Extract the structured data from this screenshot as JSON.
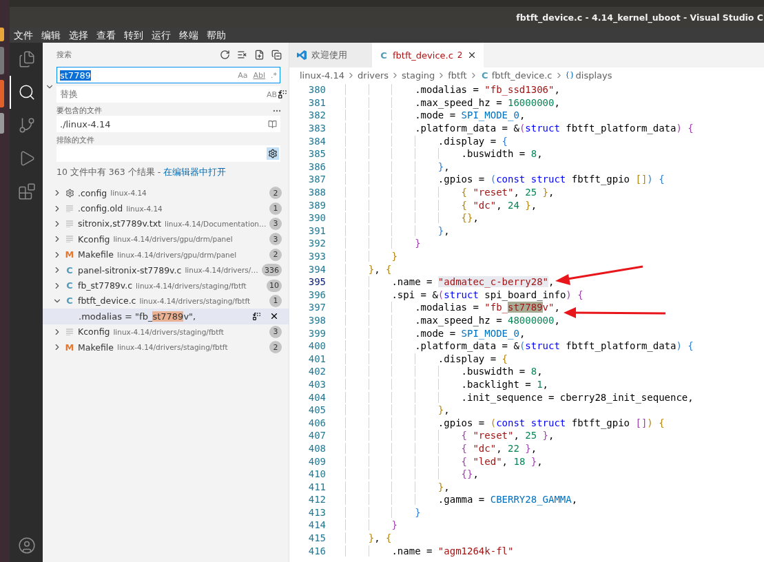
{
  "window": {
    "title": "fbtft_device.c - 4.14_kernel_uboot - Visual Studio C"
  },
  "menu": [
    "文件",
    "编辑",
    "选择",
    "查看",
    "转到",
    "运行",
    "终端",
    "帮助"
  ],
  "activity_bar": [
    {
      "kind": "files",
      "selected": false
    },
    {
      "kind": "search",
      "selected": true
    },
    {
      "kind": "branch",
      "selected": false
    },
    {
      "kind": "run",
      "selected": false
    },
    {
      "kind": "blocks",
      "selected": false
    },
    {
      "kind": "account",
      "selected": false
    }
  ],
  "search_panel": {
    "title": "搜索",
    "search": {
      "value": "st7789",
      "options": [
        "Aa",
        "Abl",
        ".*"
      ]
    },
    "replace": {
      "expanded": true,
      "placeholder": "替换",
      "option": "AB"
    },
    "include": {
      "label": "要包含的文件",
      "value": "./linux-4.14"
    },
    "exclude": {
      "label": "排除的文件",
      "use_ignore_files": true
    },
    "summary": "10 文件中有 363 个结果 - ",
    "open_in_editor": "在编辑器中打开",
    "results": [
      {
        "kind": "gear",
        "name": ".config",
        "path": "linux-4.14",
        "count": "2",
        "expanded": false
      },
      {
        "kind": "text",
        "name": ".config.old",
        "path": "linux-4.14",
        "count": "1",
        "expanded": false
      },
      {
        "kind": "text",
        "name": "sitronix,st7789v.txt",
        "path": "linux-4.14/Documentation…",
        "count": "3",
        "expanded": false
      },
      {
        "kind": "text",
        "name": "Kconfig",
        "path": "linux-4.14/drivers/gpu/drm/panel",
        "count": "3",
        "expanded": false
      },
      {
        "kind": "letter",
        "glyph": "M",
        "name": "Makefile",
        "path": "linux-4.14/drivers/gpu/drm/panel",
        "count": "2",
        "expanded": false
      },
      {
        "kind": "letter",
        "glyph": "C",
        "name": "panel-sitronix-st7789v.c",
        "path": "linux-4.14/drivers/…",
        "count": "336",
        "expanded": false
      },
      {
        "kind": "letter",
        "glyph": "C",
        "name": "fb_st7789v.c",
        "path": "linux-4.14/drivers/staging/fbtft",
        "count": "10",
        "expanded": false
      },
      {
        "kind": "letter",
        "glyph": "C",
        "name": "fbtft_device.c",
        "path": "linux-4.14/drivers/staging/fbtft",
        "count": "1",
        "expanded": true,
        "matches": [
          {
            "before": ".modalias = \"fb_",
            "match": "st7789",
            "after": "v\",",
            "selected": true
          }
        ]
      },
      {
        "kind": "text",
        "name": "Kconfig",
        "path": "linux-4.14/drivers/staging/fbtft",
        "count": "3",
        "expanded": false
      },
      {
        "kind": "letter",
        "glyph": "M",
        "name": "Makefile",
        "path": "linux-4.14/drivers/staging/fbtft",
        "count": "2",
        "expanded": false
      }
    ]
  },
  "tabs": [
    {
      "kind": "logo",
      "label": "欢迎使用",
      "selected": false
    },
    {
      "kind": "letter",
      "glyph": "C",
      "label": "fbtft_device.c",
      "problems": "2",
      "selected": true
    }
  ],
  "breadcrumb": [
    {
      "kind": "folder",
      "label": "linux-4.14"
    },
    {
      "kind": "folder",
      "label": "drivers"
    },
    {
      "kind": "folder",
      "label": "staging"
    },
    {
      "kind": "folder",
      "label": "fbtft"
    },
    {
      "kind": "letter",
      "glyph": "C",
      "label": "fbtft_device.c"
    },
    {
      "kind": "symbol",
      "label": "displays"
    }
  ],
  "code": [
    {
      "number": "380",
      "current": false,
      "tokens": [
        {
          "kind": "plain",
          "text": "            .modalias = "
        },
        {
          "kind": "string",
          "text": "\"fb_ssd1306\""
        },
        {
          "kind": "plain",
          "text": ","
        }
      ]
    },
    {
      "number": "381",
      "current": false,
      "tokens": [
        {
          "kind": "plain",
          "text": "            .max_speed_hz = "
        },
        {
          "kind": "number",
          "text": "16000000"
        },
        {
          "kind": "plain",
          "text": ","
        }
      ]
    },
    {
      "number": "382",
      "current": false,
      "tokens": [
        {
          "kind": "plain",
          "text": "            .mode = "
        },
        {
          "kind": "constant",
          "text": "SPI_MODE_0"
        },
        {
          "kind": "plain",
          "text": ","
        }
      ]
    },
    {
      "number": "383",
      "current": false,
      "tokens": [
        {
          "kind": "plain",
          "text": "            .platform_data = &"
        },
        {
          "kind": "bracket2",
          "text": "("
        },
        {
          "kind": "keyword",
          "text": "struct"
        },
        {
          "kind": "plain",
          "text": " fbtft_platform_data"
        },
        {
          "kind": "bracket2",
          "text": ") {"
        }
      ]
    },
    {
      "number": "384",
      "current": false,
      "tokens": [
        {
          "kind": "plain",
          "text": "                .display = "
        },
        {
          "kind": "bracket3",
          "text": "{"
        }
      ]
    },
    {
      "number": "385",
      "current": false,
      "tokens": [
        {
          "kind": "plain",
          "text": "                    .buswidth = "
        },
        {
          "kind": "number",
          "text": "8"
        },
        {
          "kind": "plain",
          "text": ","
        }
      ]
    },
    {
      "number": "386",
      "current": false,
      "tokens": [
        {
          "kind": "bracket3",
          "text": "                }"
        },
        {
          "kind": "plain",
          "text": ","
        }
      ]
    },
    {
      "number": "387",
      "current": false,
      "tokens": [
        {
          "kind": "plain",
          "text": "                .gpios = "
        },
        {
          "kind": "bracket3",
          "text": "("
        },
        {
          "kind": "keyword",
          "text": "const struct"
        },
        {
          "kind": "plain",
          "text": " fbtft_gpio "
        },
        {
          "kind": "bracket1",
          "text": "[]"
        },
        {
          "kind": "bracket3",
          "text": ") {"
        }
      ]
    },
    {
      "number": "388",
      "current": false,
      "tokens": [
        {
          "kind": "bracket1",
          "text": "                    {"
        },
        {
          "kind": "string",
          "text": " \"reset\""
        },
        {
          "kind": "plain",
          "text": ", "
        },
        {
          "kind": "number",
          "text": "25"
        },
        {
          "kind": "bracket1",
          "text": " }"
        },
        {
          "kind": "plain",
          "text": ","
        }
      ]
    },
    {
      "number": "389",
      "current": false,
      "tokens": [
        {
          "kind": "bracket1",
          "text": "                    {"
        },
        {
          "kind": "string",
          "text": " \"dc\""
        },
        {
          "kind": "plain",
          "text": ", "
        },
        {
          "kind": "number",
          "text": "24"
        },
        {
          "kind": "bracket1",
          "text": " }"
        },
        {
          "kind": "plain",
          "text": ","
        }
      ]
    },
    {
      "number": "390",
      "current": false,
      "tokens": [
        {
          "kind": "bracket1",
          "text": "                    {}"
        },
        {
          "kind": "plain",
          "text": ","
        }
      ]
    },
    {
      "number": "391",
      "current": false,
      "tokens": [
        {
          "kind": "bracket3",
          "text": "                }"
        },
        {
          "kind": "plain",
          "text": ","
        }
      ]
    },
    {
      "number": "392",
      "current": false,
      "tokens": [
        {
          "kind": "bracket2",
          "text": "            }"
        }
      ]
    },
    {
      "number": "393",
      "current": false,
      "tokens": [
        {
          "kind": "bracket1",
          "text": "        }"
        }
      ]
    },
    {
      "number": "394",
      "current": false,
      "tokens": [
        {
          "kind": "bracket1",
          "text": "    }"
        },
        {
          "kind": "plain",
          "text": ", "
        },
        {
          "kind": "bracket1",
          "text": "{"
        }
      ]
    },
    {
      "number": "395",
      "current": true,
      "tokens": [
        {
          "kind": "plain",
          "text": "        .name = "
        },
        {
          "kind": "string",
          "text": "\"admatec_c-berry28\"",
          "word_highlight": true
        },
        {
          "kind": "plain",
          "text": ","
        }
      ]
    },
    {
      "number": "396",
      "current": false,
      "tokens": [
        {
          "kind": "plain",
          "text": "        .spi = &"
        },
        {
          "kind": "bracket2",
          "text": "("
        },
        {
          "kind": "keyword",
          "text": "struct"
        },
        {
          "kind": "plain",
          "text": " spi_board_info"
        },
        {
          "kind": "bracket2",
          "text": ") {"
        }
      ]
    },
    {
      "number": "397",
      "current": false,
      "tokens": [
        {
          "kind": "plain",
          "text": "            .modalias = "
        },
        {
          "kind": "string",
          "text": "\"fb_"
        },
        {
          "kind": "string",
          "text": "st7789",
          "find_match": true
        },
        {
          "kind": "string",
          "text": "v\""
        },
        {
          "kind": "plain",
          "text": ","
        }
      ]
    },
    {
      "number": "398",
      "current": false,
      "tokens": [
        {
          "kind": "plain",
          "text": "            .max_speed_hz = "
        },
        {
          "kind": "number",
          "text": "48000000"
        },
        {
          "kind": "plain",
          "text": ","
        }
      ]
    },
    {
      "number": "399",
      "current": false,
      "tokens": [
        {
          "kind": "plain",
          "text": "            .mode = "
        },
        {
          "kind": "constant",
          "text": "SPI_MODE_0"
        },
        {
          "kind": "plain",
          "text": ","
        }
      ]
    },
    {
      "number": "400",
      "current": false,
      "tokens": [
        {
          "kind": "plain",
          "text": "            .platform_data = &"
        },
        {
          "kind": "bracket3",
          "text": "("
        },
        {
          "kind": "keyword",
          "text": "struct"
        },
        {
          "kind": "plain",
          "text": " fbtft_platform_data"
        },
        {
          "kind": "bracket3",
          "text": ") {"
        }
      ]
    },
    {
      "number": "401",
      "current": false,
      "tokens": [
        {
          "kind": "plain",
          "text": "                .display = "
        },
        {
          "kind": "bracket1",
          "text": "{"
        }
      ]
    },
    {
      "number": "402",
      "current": false,
      "tokens": [
        {
          "kind": "plain",
          "text": "                    .buswidth = "
        },
        {
          "kind": "number",
          "text": "8"
        },
        {
          "kind": "plain",
          "text": ","
        }
      ]
    },
    {
      "number": "403",
      "current": false,
      "tokens": [
        {
          "kind": "plain",
          "text": "                    .backlight = "
        },
        {
          "kind": "number",
          "text": "1"
        },
        {
          "kind": "plain",
          "text": ","
        }
      ]
    },
    {
      "number": "404",
      "current": false,
      "tokens": [
        {
          "kind": "plain",
          "text": "                    .init_sequence = cberry28_init_sequence,"
        }
      ]
    },
    {
      "number": "405",
      "current": false,
      "tokens": [
        {
          "kind": "bracket1",
          "text": "                }"
        },
        {
          "kind": "plain",
          "text": ","
        }
      ]
    },
    {
      "number": "406",
      "current": false,
      "tokens": [
        {
          "kind": "plain",
          "text": "                .gpios = "
        },
        {
          "kind": "bracket1",
          "text": "("
        },
        {
          "kind": "keyword",
          "text": "const struct"
        },
        {
          "kind": "plain",
          "text": " fbtft_gpio "
        },
        {
          "kind": "bracket2",
          "text": "[]"
        },
        {
          "kind": "bracket1",
          "text": ") {"
        }
      ]
    },
    {
      "number": "407",
      "current": false,
      "tokens": [
        {
          "kind": "bracket2",
          "text": "                    {"
        },
        {
          "kind": "string",
          "text": " \"reset\""
        },
        {
          "kind": "plain",
          "text": ", "
        },
        {
          "kind": "number",
          "text": "25"
        },
        {
          "kind": "bracket2",
          "text": " }"
        },
        {
          "kind": "plain",
          "text": ","
        }
      ]
    },
    {
      "number": "408",
      "current": false,
      "tokens": [
        {
          "kind": "bracket2",
          "text": "                    {"
        },
        {
          "kind": "string",
          "text": " \"dc\""
        },
        {
          "kind": "plain",
          "text": ", "
        },
        {
          "kind": "number",
          "text": "22"
        },
        {
          "kind": "bracket2",
          "text": " }"
        },
        {
          "kind": "plain",
          "text": ","
        }
      ]
    },
    {
      "number": "409",
      "current": false,
      "tokens": [
        {
          "kind": "bracket2",
          "text": "                    {"
        },
        {
          "kind": "string",
          "text": " \"led\""
        },
        {
          "kind": "plain",
          "text": ", "
        },
        {
          "kind": "number",
          "text": "18"
        },
        {
          "kind": "bracket2",
          "text": " }"
        },
        {
          "kind": "plain",
          "text": ","
        }
      ]
    },
    {
      "number": "410",
      "current": false,
      "tokens": [
        {
          "kind": "bracket2",
          "text": "                    {}"
        },
        {
          "kind": "plain",
          "text": ","
        }
      ]
    },
    {
      "number": "411",
      "current": false,
      "tokens": [
        {
          "kind": "bracket1",
          "text": "                }"
        },
        {
          "kind": "plain",
          "text": ","
        }
      ]
    },
    {
      "number": "412",
      "current": false,
      "tokens": [
        {
          "kind": "plain",
          "text": "                .gamma = "
        },
        {
          "kind": "constant",
          "text": "CBERRY28_GAMMA"
        },
        {
          "kind": "plain",
          "text": ","
        }
      ]
    },
    {
      "number": "413",
      "current": false,
      "tokens": [
        {
          "kind": "bracket3",
          "text": "            }"
        }
      ]
    },
    {
      "number": "414",
      "current": false,
      "tokens": [
        {
          "kind": "bracket2",
          "text": "        }"
        }
      ]
    },
    {
      "number": "415",
      "current": false,
      "tokens": [
        {
          "kind": "bracket1",
          "text": "    }"
        },
        {
          "kind": "plain",
          "text": ", "
        },
        {
          "kind": "bracket1",
          "text": "{"
        }
      ]
    },
    {
      "number": "416",
      "current": false,
      "tokens": [
        {
          "kind": "plain",
          "text": "        .name = "
        },
        {
          "kind": "string",
          "text": "\"agm1264k-fl\""
        }
      ]
    }
  ]
}
